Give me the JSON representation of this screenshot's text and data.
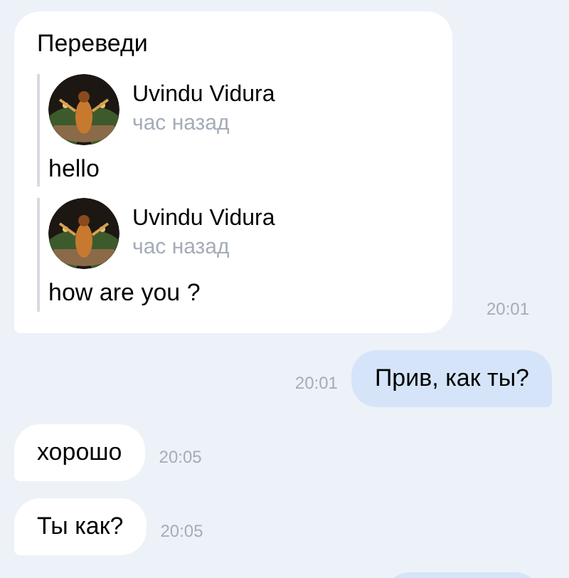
{
  "messages": [
    {
      "outgoing": false,
      "kind": "forward",
      "text": "Переведи",
      "time": "20:01",
      "forwarded": [
        {
          "author": "Uvindu Vidura",
          "when": "час назад",
          "text": "hello"
        },
        {
          "author": "Uvindu Vidura",
          "when": "час назад",
          "text": "how are you ?"
        }
      ]
    },
    {
      "outgoing": true,
      "kind": "text",
      "text": "Прив, как ты?",
      "time": "20:01"
    },
    {
      "outgoing": false,
      "kind": "text",
      "text": "хорошо",
      "time": "20:05"
    },
    {
      "outgoing": false,
      "kind": "text",
      "text": "Ты как?",
      "time": "20:05"
    },
    {
      "outgoing": true,
      "kind": "cut_off"
    }
  ]
}
